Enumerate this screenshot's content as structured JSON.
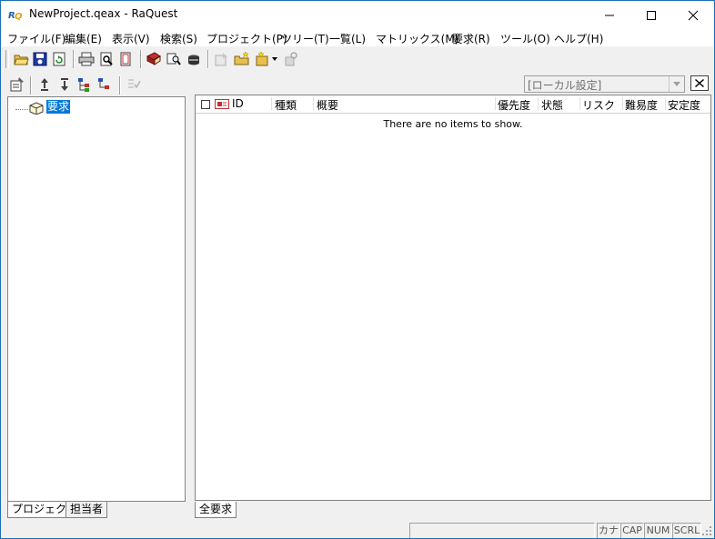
{
  "window": {
    "title": "NewProject.qeax - RaQuest"
  },
  "menu": [
    "ファイル(F)",
    "編集(E)",
    "表示(V)",
    "検索(S)",
    "プロジェクト(P)",
    "ツリー(T)",
    "一覧(L)",
    "マトリックス(M)",
    "要求(R)",
    "ツール(O)",
    "ヘルプ(H)"
  ],
  "toolbar_icons": [
    "open-folder-icon",
    "save-icon",
    "refresh-icon",
    "print-icon",
    "print-preview-icon",
    "document-icon",
    "book-icon",
    "search-book-icon",
    "database-icon",
    "properties-icon",
    "new-folder-icon",
    "add-item-icon",
    "settings-icon"
  ],
  "tree": {
    "root_label": "要求"
  },
  "left_tabs": [
    "プロジェクト",
    "担当者"
  ],
  "right": {
    "view_setting": "[ローカル設定]",
    "columns": [
      "ID",
      "種類",
      "概要",
      "優先度",
      "状態",
      "リスク",
      "難易度",
      "安定度"
    ],
    "empty_message": "There are no items to show.",
    "tab": "全要求"
  },
  "status": {
    "kana": "カナ",
    "cap": "CAP",
    "num": "NUM",
    "scrl": "SCRL"
  }
}
